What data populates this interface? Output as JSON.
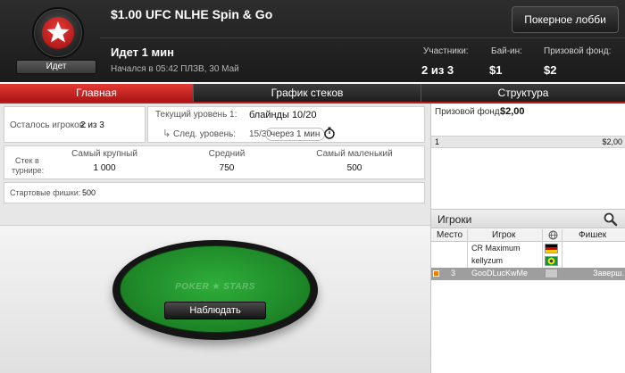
{
  "header": {
    "title": "$1.00 UFC NLHE Spin & Go",
    "status_badge": "Идет",
    "lobby_button": "Покерное лобби",
    "running": "Идет 1 мин",
    "started": "Начался в 05:42 ПЛЗВ, 30 Май",
    "stats": [
      {
        "label": "Участники:",
        "value": "2 из 3"
      },
      {
        "label": "Бай-ин:",
        "value": "$1"
      },
      {
        "label": "Призовой фонд:",
        "value": "$2"
      }
    ]
  },
  "tabs": [
    {
      "label": "Главная",
      "active": true
    },
    {
      "label": "График стеков",
      "active": false
    },
    {
      "label": "Структура",
      "active": false
    }
  ],
  "info": {
    "players_left_label": "Осталось игроков:",
    "players_left_value": "2 из 3",
    "current_level_label": "Текущий уровень 1:",
    "current_level_value": "блайнды 10/20",
    "next_level_label": "След. уровень:",
    "next_level_value": "15/30",
    "next_level_time": "через 1 мин",
    "stack_label_line1": "Стек в",
    "stack_label_line2": "турнире:",
    "stack_columns": [
      {
        "label": "Самый крупный",
        "value": "1 000"
      },
      {
        "label": "Средний",
        "value": "750"
      },
      {
        "label": "Самый маленький",
        "value": "500"
      }
    ],
    "start_chips_label": "Стартовые фишки:",
    "start_chips_value": "500"
  },
  "table": {
    "logo_text": "POKER ★ STARS",
    "watch_button": "Наблюдать",
    "felt_color": "#1f8a29"
  },
  "prize": {
    "label": "Призовой фонд:",
    "value": "$2,00",
    "rows": [
      {
        "place": "1",
        "amount": "$2,00"
      }
    ]
  },
  "players": {
    "title": "Игроки",
    "columns": {
      "place": "Место",
      "player": "Игрок",
      "chips": "Фишек"
    },
    "rows": [
      {
        "place": "",
        "name": "CR Maximum",
        "flag": "de",
        "chips": "",
        "highlighted": false
      },
      {
        "place": "",
        "name": "kellyzum",
        "flag": "br",
        "chips": "",
        "highlighted": false
      },
      {
        "place": "3",
        "name": "GooDLucKwMe",
        "flag": "none",
        "chips": "Заверш.",
        "highlighted": true
      }
    ]
  },
  "colors": {
    "accent_red": "#c62828",
    "header_bg": "#1f1f1f",
    "highlight_row": "#9e9e9e"
  }
}
